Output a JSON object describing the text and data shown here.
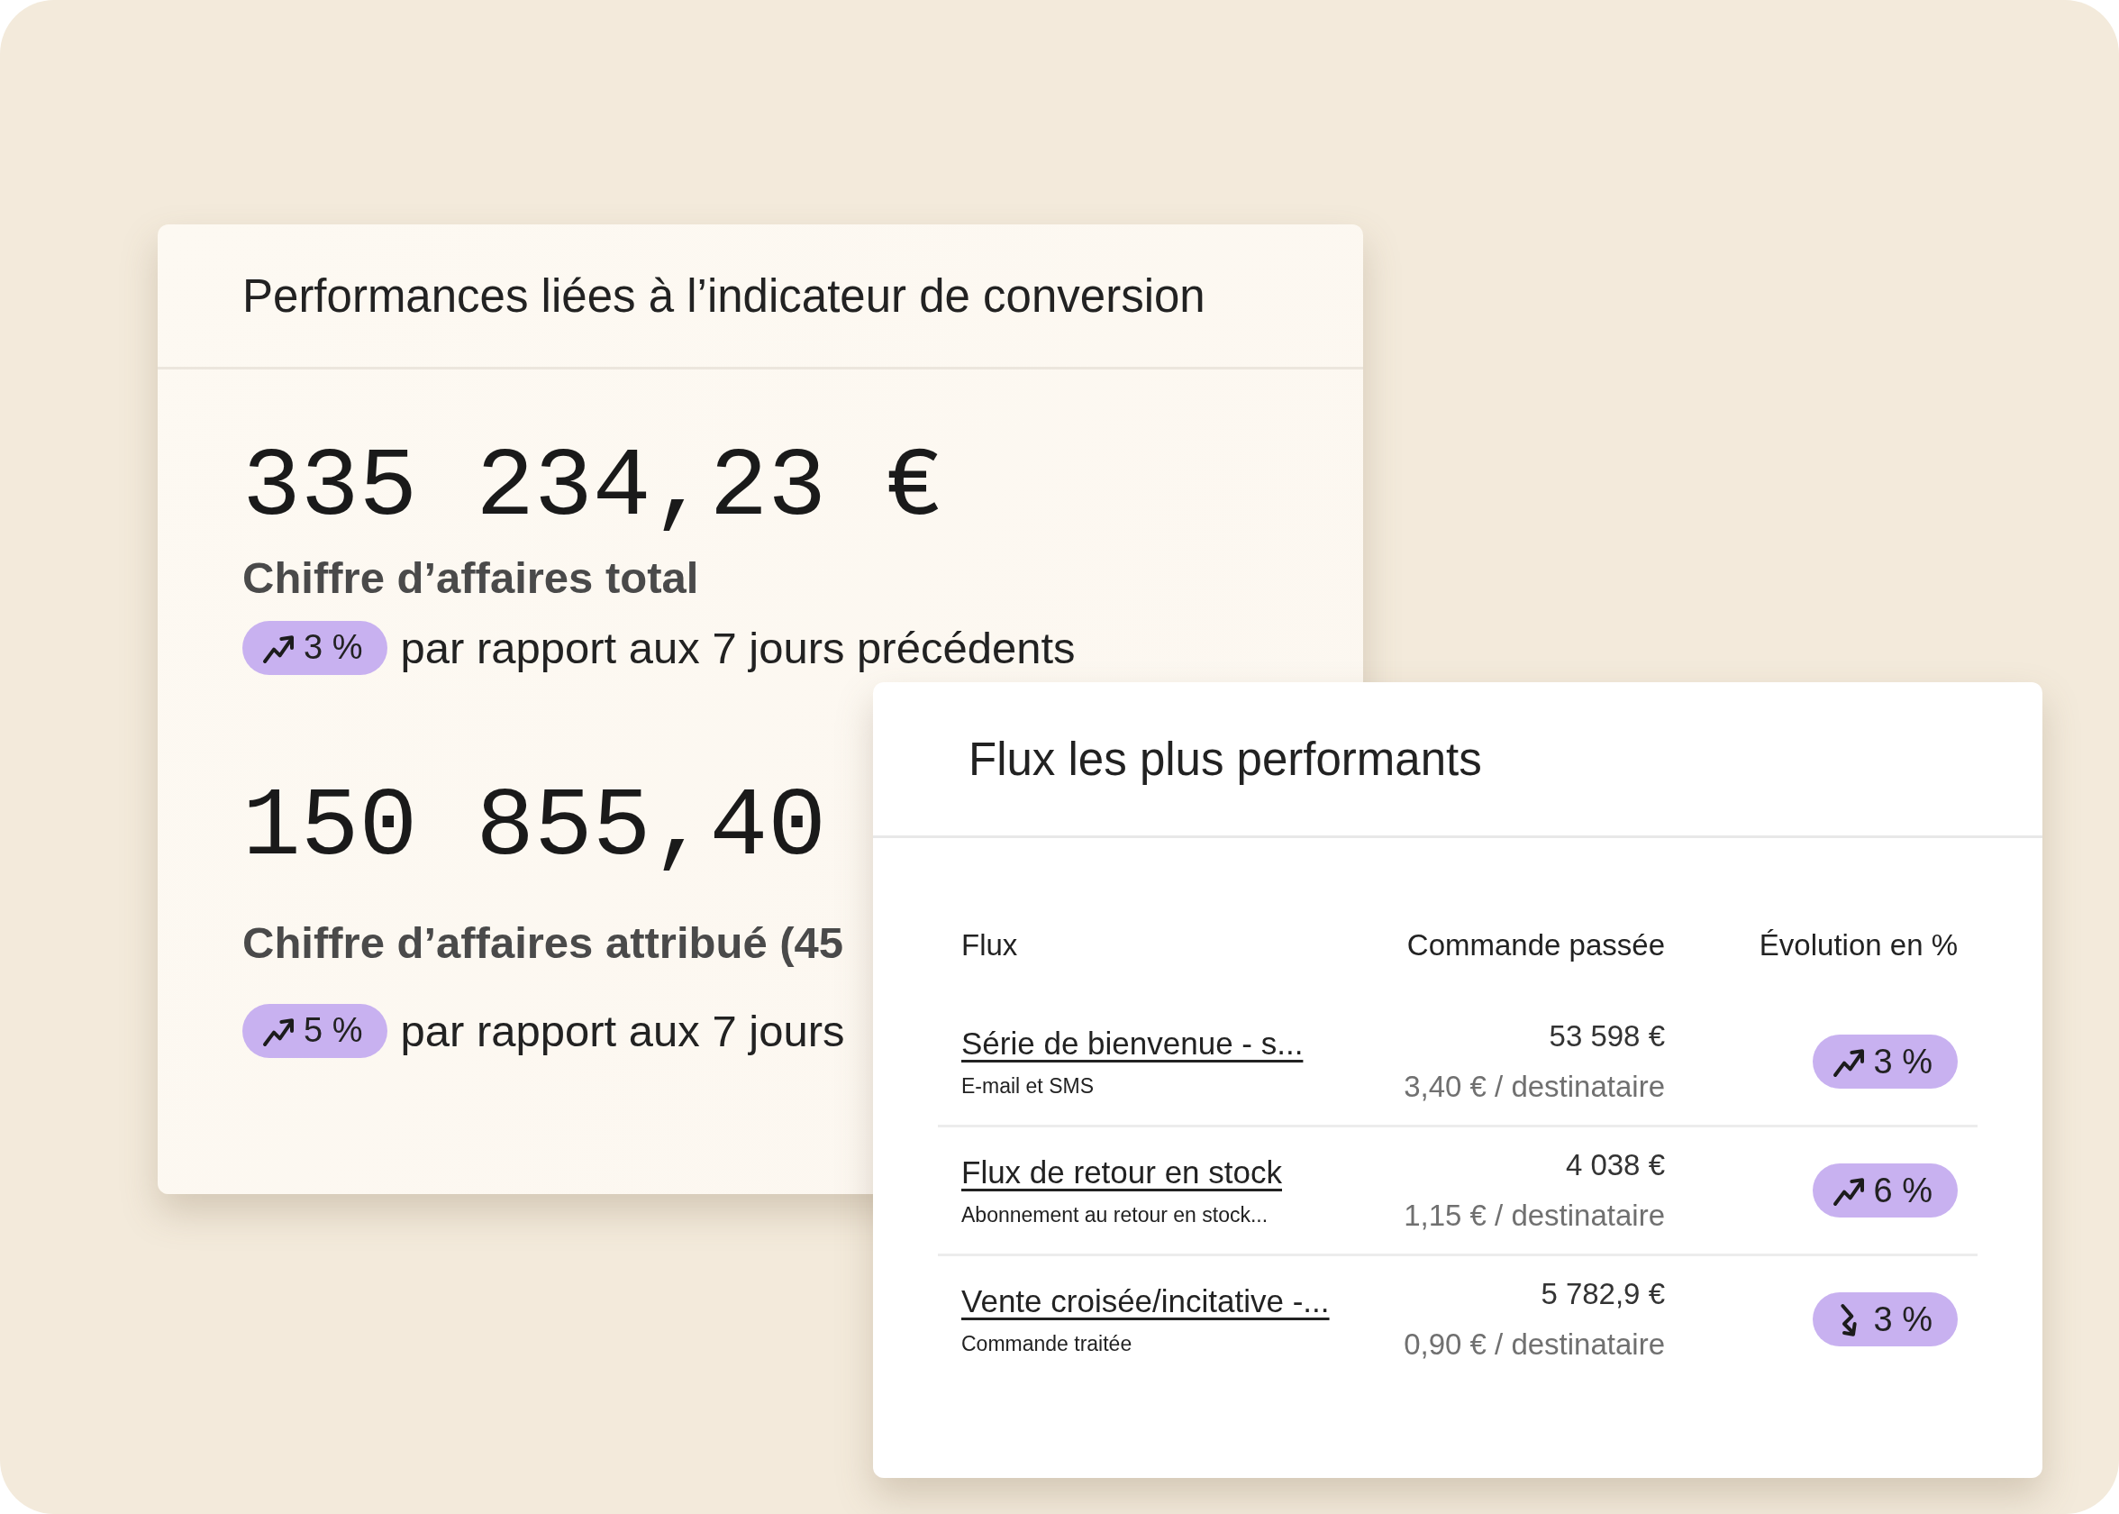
{
  "conversion_card": {
    "title": "Performances liées à l’indicateur de conversion",
    "metrics": [
      {
        "value": "335 234,23 €",
        "label": "Chiffre d’affaires total",
        "change": {
          "rising": true,
          "text": "3 %"
        },
        "comparison": "par rapport aux 7 jours précédents"
      },
      {
        "value": "150 855,40",
        "label": "Chiffre d’affaires attribué (45",
        "change": {
          "rising": true,
          "text": "5 %"
        },
        "comparison": "par rapport aux 7 jours"
      }
    ]
  },
  "flows_card": {
    "title": "Flux les plus performants",
    "table": {
      "columns": [
        "Flux",
        "Commande passée",
        "Évolution en %"
      ],
      "rows": [
        {
          "name": "Série de bienvenue - s...",
          "subtitle": "E-mail et SMS",
          "orders": "53 598 €",
          "per_recipient": "3,40 € / destinataire",
          "change": {
            "rising": true,
            "text": "3 %"
          }
        },
        {
          "name": "Flux de retour en stock",
          "subtitle": "Abonnement au retour en stock...",
          "orders": "4 038 €",
          "per_recipient": "1,15 € / destinataire",
          "change": {
            "rising": true,
            "text": "6 %"
          }
        },
        {
          "name": "Vente croisée/incitative -...",
          "subtitle": "Commande traitée",
          "orders": "5 782,9 €",
          "per_recipient": "0,90 € / destinataire",
          "change": {
            "rising": false,
            "text": "3 %"
          }
        }
      ]
    }
  }
}
